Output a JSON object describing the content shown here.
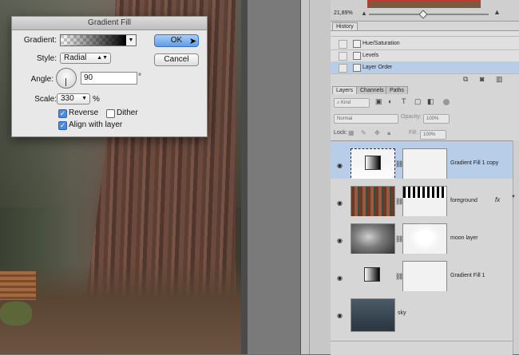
{
  "dialog": {
    "title": "Gradient Fill",
    "gradient_label": "Gradient:",
    "style_label": "Style:",
    "style_value": "Radial",
    "angle_label": "Angle:",
    "angle_value": "90",
    "angle_unit": "°",
    "scale_label": "Scale:",
    "scale_value": "330",
    "scale_unit": "%",
    "reverse_label": "Reverse",
    "reverse_checked": true,
    "dither_label": "Dither",
    "dither_checked": false,
    "align_label": "Align with layer",
    "align_checked": true,
    "ok_label": "OK",
    "cancel_label": "Cancel"
  },
  "navigator": {
    "zoom": "21,89%"
  },
  "history": {
    "tab_label": "History",
    "items": [
      {
        "label": "Hue/Saturation",
        "selected": false
      },
      {
        "label": "Levels",
        "selected": false
      },
      {
        "label": "Layer Order",
        "selected": true
      }
    ]
  },
  "layers_panel": {
    "tabs": [
      "Layers",
      "Channels",
      "Paths"
    ],
    "kind_filter": "Kind",
    "blend_mode": "Normal",
    "opacity_label": "Opacity:",
    "opacity_value": "100%",
    "lock_label": "Lock:",
    "fill_label": "Fill:",
    "fill_value": "100%",
    "layers": [
      {
        "name": "Gradient Fill 1 copy",
        "selected": true,
        "has_mask": true,
        "fx": ""
      },
      {
        "name": "foreground",
        "selected": false,
        "has_mask": true,
        "fx": "fx"
      },
      {
        "name": "moon layer",
        "selected": false,
        "has_mask": true,
        "fx": ""
      },
      {
        "name": "Gradient Fill 1",
        "selected": false,
        "has_mask": true,
        "fx": ""
      },
      {
        "name": "sky",
        "selected": false,
        "has_mask": false,
        "fx": ""
      }
    ]
  },
  "icons": {
    "visibility": "eye-icon",
    "link": "chain-link-icon",
    "cursor": "mouse-pointer-icon"
  }
}
